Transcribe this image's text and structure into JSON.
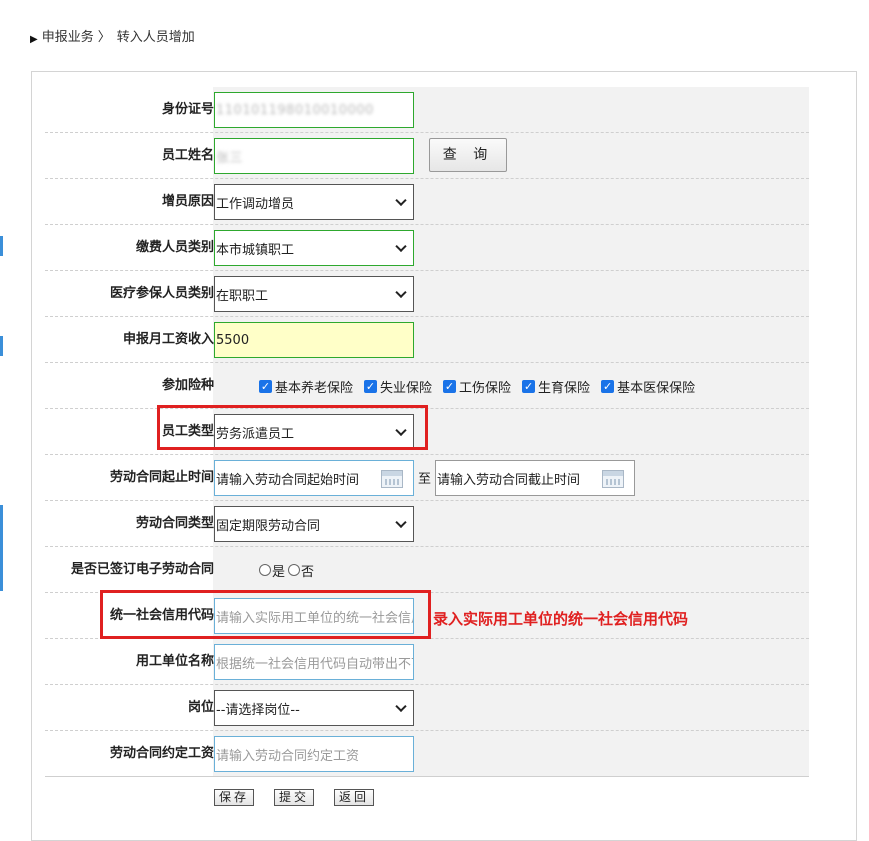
{
  "breadcrumb": {
    "section": "申报业务",
    "separator": "〉",
    "current": "转入人员增加"
  },
  "form": {
    "id_number": {
      "label": "身份证号",
      "value": "110101198010010000"
    },
    "name": {
      "label": "员工姓名",
      "value": "张三"
    },
    "query_button": "查 询",
    "reason": {
      "label": "增员原因",
      "value": "工作调动增员"
    },
    "payer_type": {
      "label": "缴费人员类别",
      "value": "本市城镇职工"
    },
    "medical_type": {
      "label": "医疗参保人员类别",
      "value": "在职职工"
    },
    "salary": {
      "label": "申报月工资收入",
      "value": "5500"
    },
    "insurance": {
      "label": "参加险种",
      "options": [
        {
          "label": "基本养老保险",
          "checked": true
        },
        {
          "label": "失业保险",
          "checked": true
        },
        {
          "label": "工伤保险",
          "checked": true
        },
        {
          "label": "生育保险",
          "checked": true
        },
        {
          "label": "基本医保保险",
          "checked": true
        }
      ]
    },
    "employee_type": {
      "label": "员工类型",
      "value": "劳务派遣员工"
    },
    "contract_period": {
      "label": "劳动合同起止时间",
      "start_placeholder": "请输入劳动合同起始时间",
      "to": "至",
      "end_placeholder": "请输入劳动合同截止时间"
    },
    "contract_type": {
      "label": "劳动合同类型",
      "value": "固定期限劳动合同"
    },
    "e_contract": {
      "label": "是否已签订电子劳动合同",
      "yes": "是",
      "no": "否"
    },
    "credit_code": {
      "label": "统一社会信用代码",
      "placeholder": "请输入实际用工单位的统一社会信用代码"
    },
    "employer_name": {
      "label": "用工单位名称",
      "placeholder": "根据统一社会信用代码自动带出不可修改"
    },
    "position": {
      "label": "岗位",
      "value": "--请选择岗位--"
    },
    "contract_salary": {
      "label": "劳动合同约定工资",
      "placeholder": "请输入劳动合同约定工资"
    }
  },
  "annotation": "录入实际用工单位的统一社会信用代码",
  "buttons": {
    "save": "保存",
    "submit": "提交",
    "back": "返回"
  },
  "colors": {
    "highlight": "#e02020",
    "checkbox": "#1a73e8",
    "valid_border": "#2ea82e"
  }
}
